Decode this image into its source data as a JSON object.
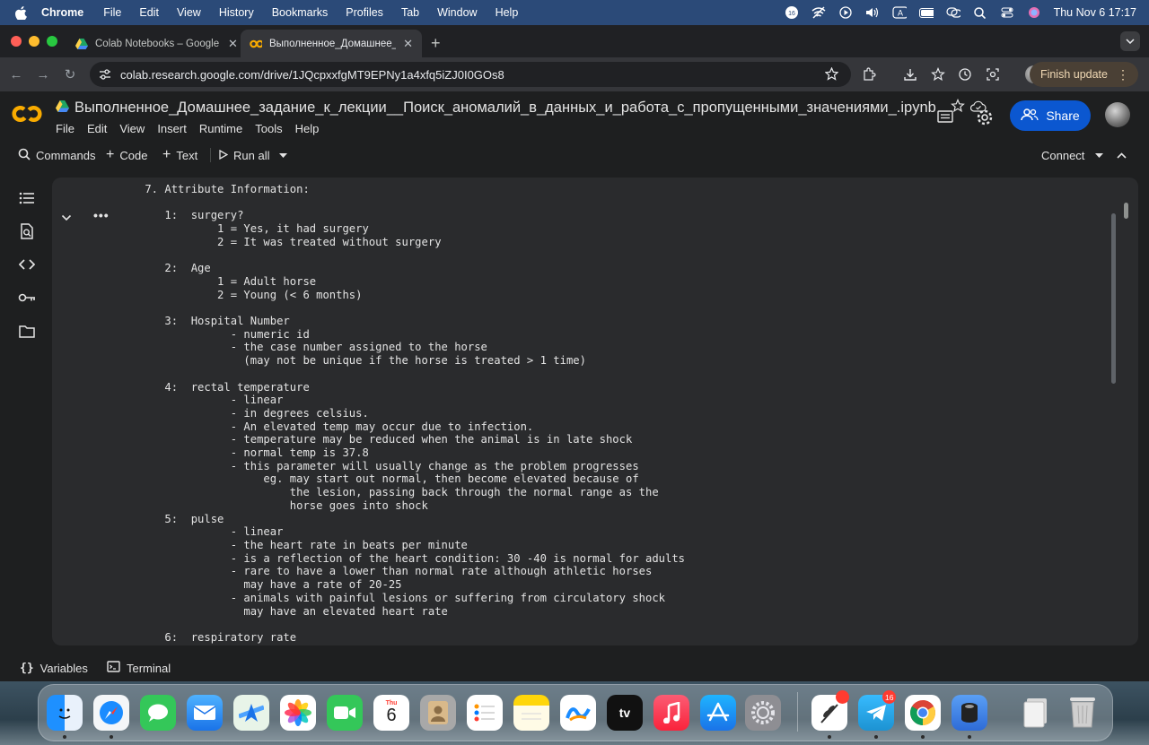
{
  "menubar": {
    "app": "Chrome",
    "items": [
      "File",
      "Edit",
      "View",
      "History",
      "Bookmarks",
      "Profiles",
      "Tab",
      "Window",
      "Help"
    ],
    "datetime": "Thu Nov 6  17:17",
    "badge_count": "16"
  },
  "tabs": [
    {
      "title": "Colab Notebooks – Google Д",
      "active": false
    },
    {
      "title": "Выполненное_Домашнее_з",
      "active": true
    }
  ],
  "address": {
    "url": "colab.research.google.com/drive/1JQcpxxfgMT9EPNy1a4xfq5iZJ0I0GOs8",
    "finish_update": "Finish update"
  },
  "notebook": {
    "title": "Выполненное_Домашнее_задание_к_лекции__Поиск_аномалий_в_данных_и_работа_с_пропущенными_значениями_.ipynb",
    "menu": [
      "File",
      "Edit",
      "View",
      "Insert",
      "Runtime",
      "Tools",
      "Help"
    ],
    "share": "Share"
  },
  "commands": {
    "commands": "Commands",
    "code": "Code",
    "text": "Text",
    "run_all": "Run all",
    "connect": "Connect"
  },
  "cell_text": "    7. Attribute Information:\n\n       1:  surgery?\n               1 = Yes, it had surgery\n               2 = It was treated without surgery\n\n       2:  Age\n               1 = Adult horse\n               2 = Young (< 6 months)\n\n       3:  Hospital Number\n                 - numeric id\n                 - the case number assigned to the horse\n                   (may not be unique if the horse is treated > 1 time)\n\n       4:  rectal temperature\n                 - linear\n                 - in degrees celsius.\n                 - An elevated temp may occur due to infection.\n                 - temperature may be reduced when the animal is in late shock\n                 - normal temp is 37.8\n                 - this parameter will usually change as the problem progresses\n                      eg. may start out normal, then become elevated because of\n                          the lesion, passing back through the normal range as the\n                          horse goes into shock\n       5:  pulse\n                 - linear\n                 - the heart rate in beats per minute\n                 - is a reflection of the heart condition: 30 -40 is normal for adults\n                 - rare to have a lower than normal rate although athletic horses\n                   may have a rate of 20-25\n                 - animals with painful lesions or suffering from circulatory shock\n                   may have an elevated heart rate\n\n       6:  respiratory rate",
  "bottom": {
    "variables": "Variables",
    "terminal": "Terminal"
  },
  "dock": {
    "calendar_month": "Thu",
    "calendar_day": "6",
    "tv_label": "tv",
    "telegram_badge": "16"
  }
}
